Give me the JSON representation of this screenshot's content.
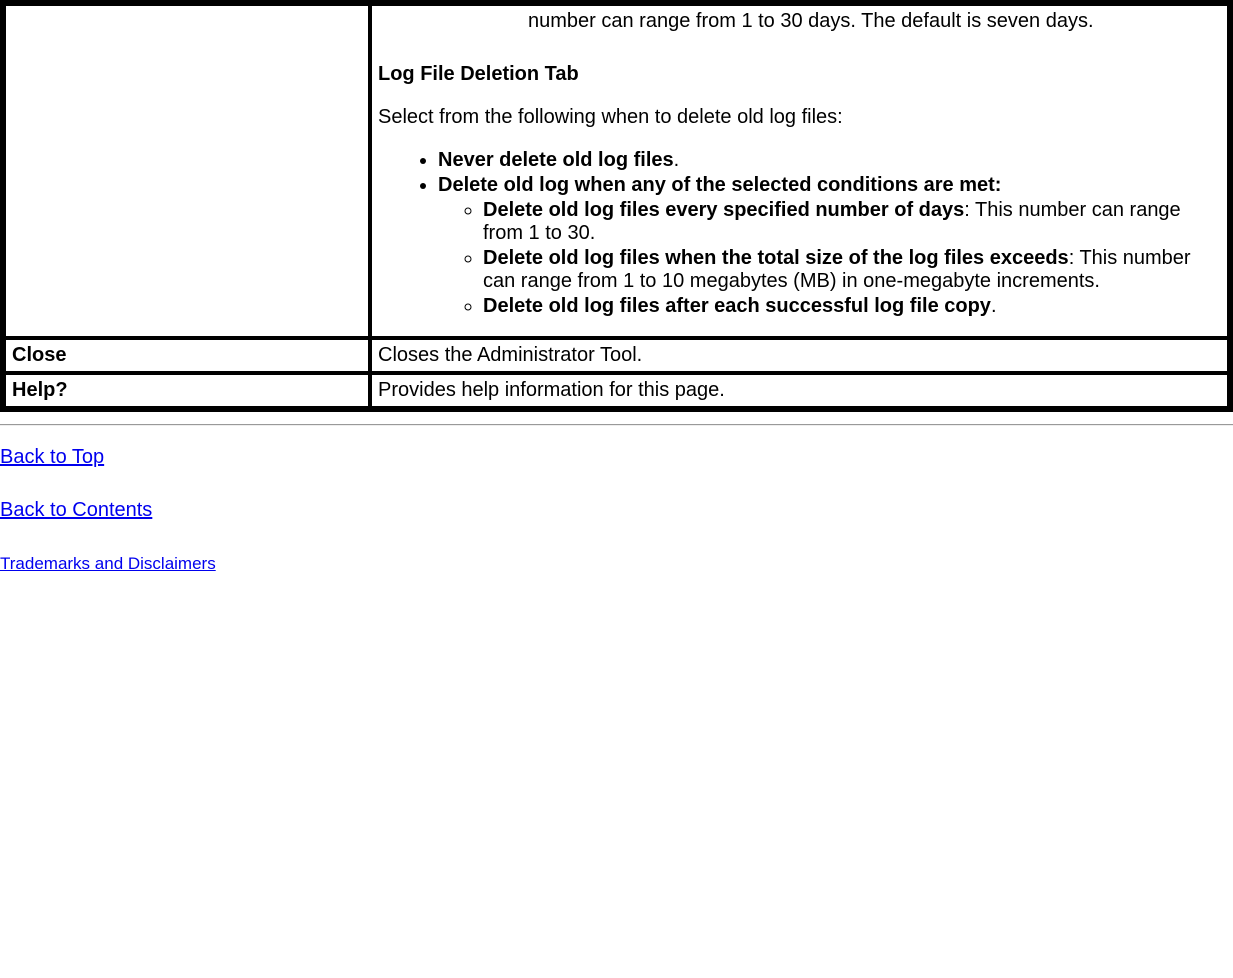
{
  "topCell": {
    "topText": "number can range from 1 to 30 days. The default is seven days.",
    "sectionHeading": "Log File Deletion Tab",
    "introText": "Select from the following when to delete old log files:",
    "bullet1": "Never delete old log files",
    "bullet1_suffix": ".",
    "bullet2": "Delete old log when any of the selected conditions are met:",
    "sub1_bold": "Delete old log files every specified number of days",
    "sub1_rest": ": This number can range from 1 to 30.",
    "sub2_bold": "Delete old log files when the total size of the log files exceeds",
    "sub2_rest": ": This number can range from 1 to 10 megabytes (MB) in one-megabyte increments.",
    "sub3_bold": "Delete old log files after each successful log file copy",
    "sub3_suffix": "."
  },
  "row2": {
    "left": "Close",
    "right": "Closes the Administrator Tool."
  },
  "row3": {
    "left": "Help?",
    "right": "Provides help information for this page."
  },
  "links": {
    "backToTop": "Back to Top",
    "backToContents": "Back to Contents",
    "trademarks": "Trademarks and Disclaimers"
  }
}
